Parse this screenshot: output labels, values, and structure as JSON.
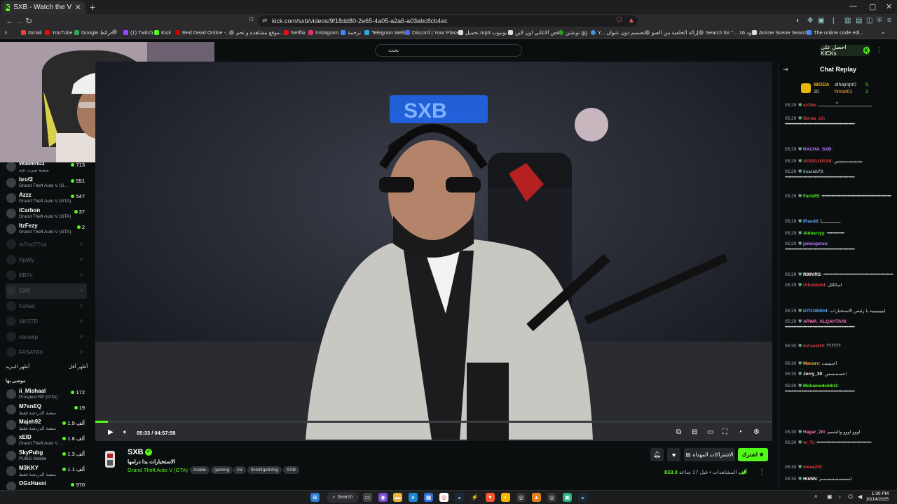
{
  "browser": {
    "tab_title": "SXB - Watch the VOD on Kick",
    "url": "kick.com/sxb/videos/9f18dd80-2e65-4a05-a2a6-a03ebc8cb4ec",
    "bookmarks": [
      "Gmail",
      "YouTube",
      "Google خرائط",
      "(1) Twitch",
      "Kick",
      "Red Dead Online -...",
      "موقع مشاهدة و تحم...",
      "Netflix",
      "Instagram",
      "ترجمة",
      "Telegram Web",
      "Discord | Your Place...",
      "تحميل mp3 يوتيوب",
      "قص الاغاني اون لاين...",
      "توتشن gg",
      "Y... تصميم دون عنوان",
      "إزالة الخلفية من الصو...",
      "Search for \"... كود 16",
      "Anime Scene Search...",
      "The online code edi..."
    ]
  },
  "header": {
    "search_placeholder": "بحث",
    "get_kicks": "احصل على KICKs"
  },
  "sidebar": {
    "channels": [
      {
        "name": "Waleen03",
        "game": "منصة صرت عنه",
        "count": "713"
      },
      {
        "name": "brof2",
        "game": "Grand Theft Auto V (G...",
        "count": "551"
      },
      {
        "name": "Azzz",
        "game": "Grand Theft Auto V (GTA)",
        "count": "547"
      },
      {
        "name": "iCarbon",
        "game": "Grand Theft Auto V (GTA)",
        "count": "37"
      },
      {
        "name": "ItzFezy",
        "game": "Grand Theft Auto V (GTA)",
        "count": "2"
      }
    ],
    "offline": [
      "m7md77sa",
      "RpWy",
      "BB7rr",
      "SXB",
      "Fahad",
      "NKSTR",
      "vacwep",
      "FASATA0"
    ],
    "show_more": "أظهر المزيد",
    "show_less": "أظهر أقل",
    "recommended_label": "موصى بها",
    "recommended": [
      {
        "name": "ii_Mishaal",
        "game": "Prospect RP (GTA)",
        "count": "172"
      },
      {
        "name": "M7snEQ",
        "game": "منصة الدردشة فقط",
        "count": "19"
      },
      {
        "name": "Majeh92",
        "game": "منصة الدردشة فقط",
        "count": "1.9 ألف"
      },
      {
        "name": "xEID",
        "game": "Grand Theft Auto V ...",
        "count": "1.8 ألف"
      },
      {
        "name": "SkyPubg",
        "game": "PUBG Mobile",
        "count": "1.3 ألف"
      },
      {
        "name": "M3KKY",
        "game": "منصة الدردشة فقط",
        "count": "1.1 ألف"
      },
      {
        "name": "OGxHusni",
        "game": "",
        "count": "970"
      }
    ]
  },
  "player": {
    "time": "05:33 / 04:57:59",
    "progress": 0.019
  },
  "stream": {
    "streamer": "SXB",
    "title": "الاستخبارات بدا درامها",
    "game": "Grand Theft Auto V (GTA)",
    "tags": [
      "Arabic",
      "gaming",
      "rnr",
      "5HoNgx8oNg",
      "SXB"
    ],
    "subscribe": "اشترك",
    "gift_subs": "الاشتراكات المهداة",
    "viewers": "833.3 ألف",
    "views_label": "المشاهدات",
    "ago": "قبل 17 ساعة"
  },
  "chat": {
    "title": "Chat Replay",
    "gifters": [
      {
        "name": "IBODA",
        "count": "20"
      },
      {
        "name": "alhajriqtr0",
        "count": "5"
      },
      {
        "name": "hmod01",
        "count": "2"
      }
    ],
    "messages": [
      {
        "time": "05:29",
        "user": "ez3lm",
        "color": "#e63c3c",
        "text": "ــــــــــــــــــــــــــــــــــــــــ"
      },
      {
        "time": "05:29",
        "user": "lSrraa_d1",
        "color": "#e63c3c",
        "text": "••••••••••••••••••••••••••••••••••••••••••••••••••••••••"
      },
      {
        "time": "05:29",
        "user": "RACHA_SXB",
        "color": "#b77cff",
        "text": ""
      },
      {
        "time": "05:29",
        "user": "ASSELIDSX8",
        "color": "#e63c3c",
        "text": "مسسسسسس"
      },
      {
        "time": "05:29",
        "user": "iisarah73",
        "color": "#9ab",
        "text": "••••••••••••••••••••••••••••••••••••••••••••••••••••••••"
      },
      {
        "time": "05:29",
        "user": "Faris55",
        "color": "#53fc18",
        "text": "••••••••••••••••••••••••••••••••••••••••••••••••••••••••"
      },
      {
        "time": "05:29",
        "user": "lRaed0",
        "color": "#5aa8ff",
        "text": "ــــــــــــــا"
      },
      {
        "time": "05:29",
        "user": "Aldosrryy",
        "color": "#53fc18",
        "text": "••••••••••••••"
      },
      {
        "time": "05:29",
        "user": "jadengetsu",
        "color": "#b77cff",
        "text": "••••••••••••••••••••••••••••••••••••••••••••••••••••••••"
      },
      {
        "time": "05:29",
        "user": "R99VRS",
        "color": "#fff",
        "text": "••••••••••••••••••••••••••••••••••••••••••••••••••••••••"
      },
      {
        "time": "05:29",
        "user": "iAbsidand",
        "color": "#e63c3c",
        "text": "اسالللل"
      },
      {
        "time": "05:29",
        "user": "D7OOM504",
        "color": "#5aa8ff",
        "text": "ايييييييييه يا رئيس الاستخبارات"
      },
      {
        "time": "05:29",
        "user": "ARWA_ALQAHTANI",
        "color": "#ff6fb5",
        "text": "••••••••••••••••••••••••••••••••••••••••••••••••••••••••"
      },
      {
        "time": "05:30",
        "user": "isAseel10",
        "color": "#e63c3c",
        "text": "؟؟؟؟؟؟"
      },
      {
        "time": "05:30",
        "user": "Manarv",
        "color": "#ffb347",
        "text": "احبببببب"
      },
      {
        "time": "05:30",
        "user": "Jorry_30",
        "color": "#fff",
        "text": "احسسسس"
      },
      {
        "time": "05:30",
        "user": "Mohamedeldin3",
        "color": "#53fc18",
        "text": "••••••••••••••••••••••••••••••••••••••••••••••••••••••••"
      },
      {
        "time": "05:30",
        "user": "Hagar_2lii",
        "color": "#ff6fb5",
        "text": "اووو اووو والشمم"
      },
      {
        "time": "05:30",
        "user": "m_7r",
        "color": "#e63c3c",
        "text": "••••••••••••••••••••••••••••••••••••••••••••"
      },
      {
        "time": "05:30",
        "user": "meee2f2",
        "color": "#e63c3c",
        "text": ""
      },
      {
        "time": "05:30",
        "user": "HiiiNN",
        "color": "#fff",
        "text": "اسسسسسسسم"
      }
    ]
  },
  "taskbar": {
    "search": "Search",
    "time": "1:30 PM",
    "date": "10/14/2025"
  },
  "colors": {
    "accent": "#53fc18",
    "background": "#0b0e0f"
  }
}
